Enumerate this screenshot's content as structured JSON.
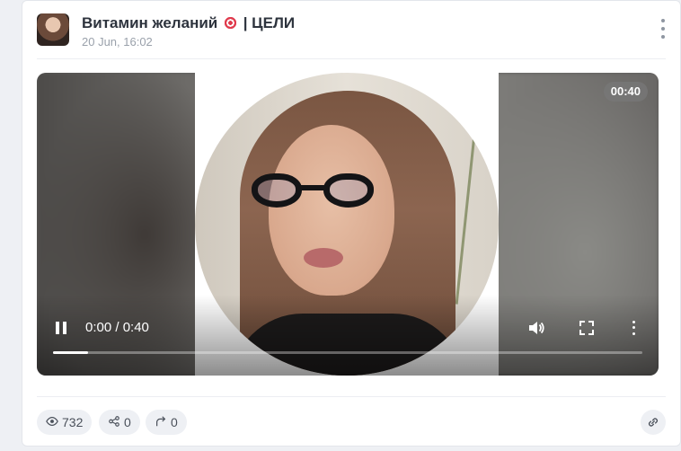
{
  "post": {
    "channel_name": "Витамин желаний",
    "channel_tag": "| ЦЕЛИ",
    "timestamp": "20 Jun, 16:02"
  },
  "video": {
    "duration_badge": "00:40",
    "time_display": "0:00 / 0:40",
    "progress_fraction": 0.06
  },
  "stats": {
    "views": "732",
    "shares": "0",
    "forwards": "0"
  },
  "icons": {
    "more": "more-vertical-icon",
    "pause": "pause-icon",
    "volume": "volume-icon",
    "fullscreen": "fullscreen-icon",
    "eye": "eye-icon",
    "share": "share-icon",
    "forward": "forward-icon",
    "link": "link-icon",
    "target_emoji": "direct-hit-emoji"
  }
}
